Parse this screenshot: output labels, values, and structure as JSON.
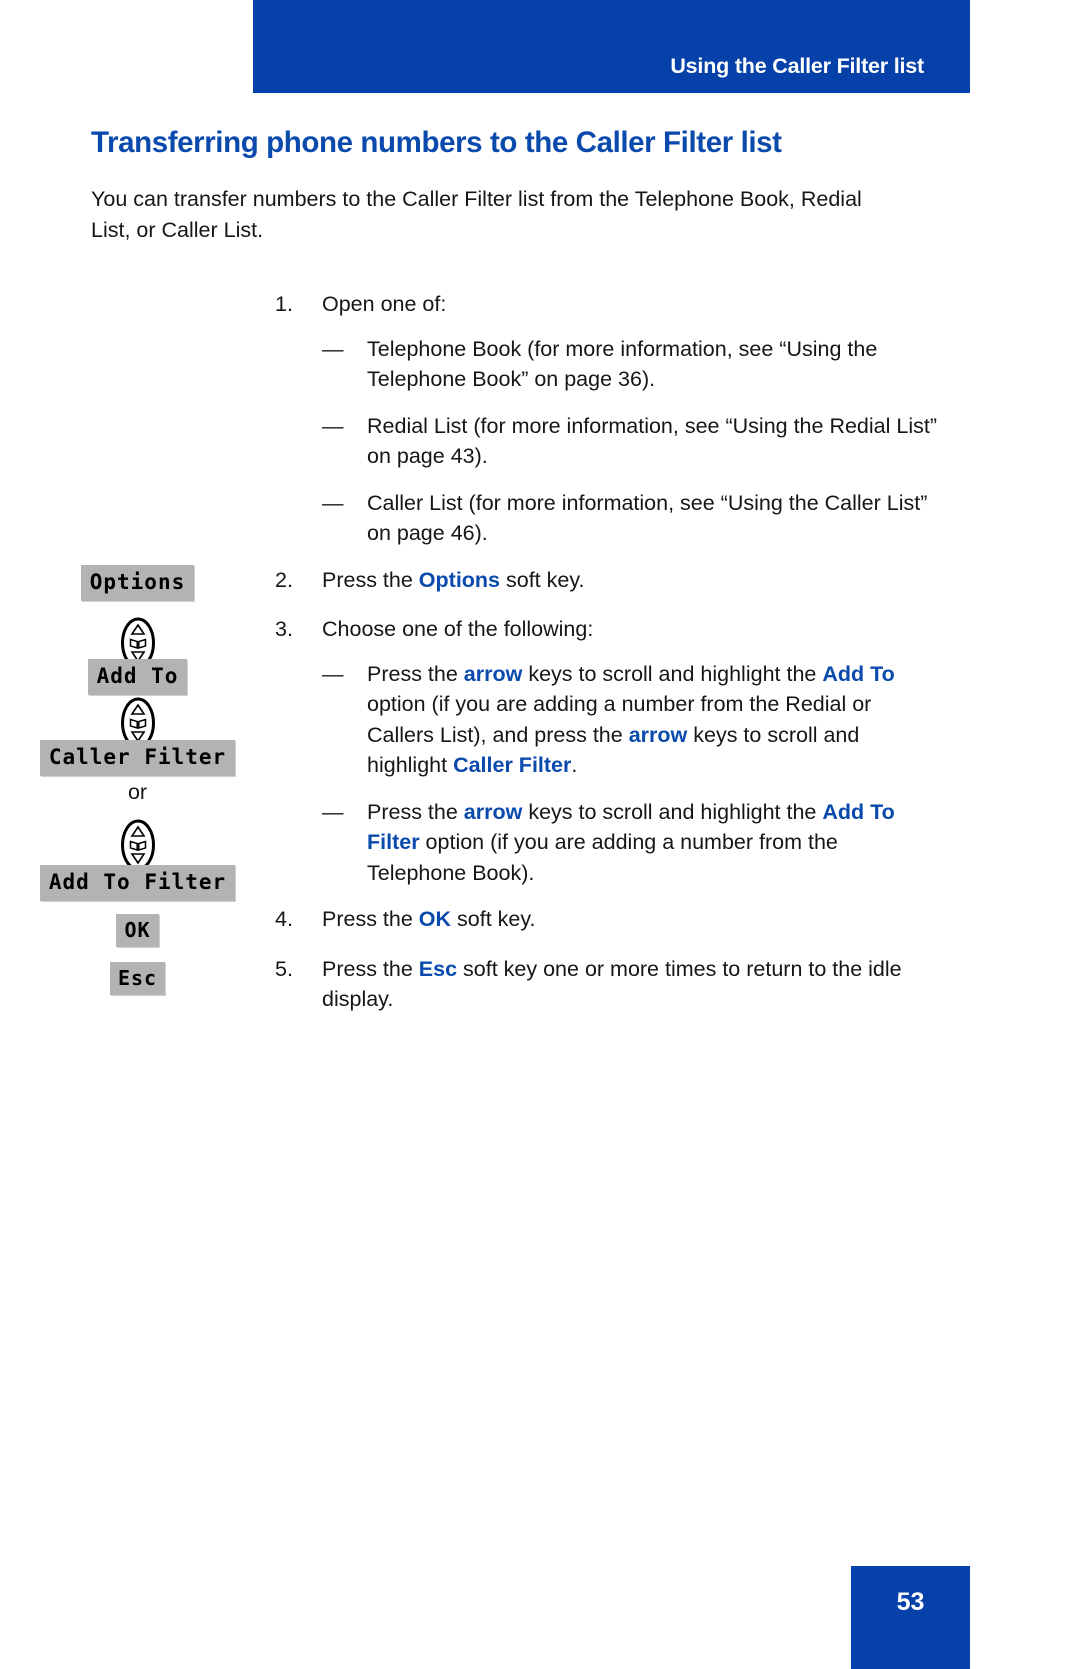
{
  "header": {
    "running_title": "Using the Caller Filter list",
    "band_color": "#0541a8"
  },
  "heading": "Transferring phone numbers to the Caller Filter list",
  "heading_color": "#0a4aad",
  "intro": "You can transfer numbers to the Caller Filter list from the Telephone Book, Redial List, or Caller List.",
  "steps": [
    {
      "number": "1.",
      "text": "Open one of:",
      "sub_items": [
        {
          "mark": "—",
          "text": "Telephone Book (for more information, see “Using the Telephone Book” on page 36)."
        },
        {
          "mark": "—",
          "text": "Redial List (for more information, see “Using the Redial List” on page 43)."
        },
        {
          "mark": "—",
          "text": "Caller List (for more information, see “Using the Caller List” on page 46)."
        }
      ]
    },
    {
      "number": "2.",
      "text_before": "Press the ",
      "keyword": "Options",
      "text_after": " soft key."
    },
    {
      "number": "3.",
      "text": "Choose one of the following:",
      "sub_items": [
        {
          "mark": "—",
          "parts": [
            {
              "t": "Press the ",
              "kw": false
            },
            {
              "t": "arrow",
              "kw": true
            },
            {
              "t": " keys to scroll and highlight the ",
              "kw": false
            },
            {
              "t": "Add To",
              "kw": true
            },
            {
              "t": " option (if you are adding a number from the Redial or Callers List), and press the ",
              "kw": false
            },
            {
              "t": "arrow",
              "kw": true
            },
            {
              "t": " keys to scroll and highlight ",
              "kw": false
            },
            {
              "t": "Caller Filter",
              "kw": true
            },
            {
              "t": ".",
              "kw": false
            }
          ]
        },
        {
          "mark": "—",
          "parts": [
            {
              "t": "Press the ",
              "kw": false
            },
            {
              "t": "arrow",
              "kw": true
            },
            {
              "t": " keys to scroll and highlight the ",
              "kw": false
            },
            {
              "t": "Add To Filter",
              "kw": true
            },
            {
              "t": " option (if you are adding a number from the Telephone Book).",
              "kw": false
            }
          ]
        }
      ]
    },
    {
      "number": "4.",
      "text_before": "Press the ",
      "keyword": "OK",
      "text_after": " soft key."
    },
    {
      "number": "5.",
      "text_before": "Press the ",
      "keyword": "Esc",
      "text_after": " soft key one or more times to return to the idle display."
    }
  ],
  "margin_graphics": {
    "lcd_options": "Options",
    "lcd_add_to": "Add To",
    "lcd_caller_filter": "Caller Filter",
    "or_label": "or",
    "lcd_add_to_filter": "Add To Filter",
    "lcd_ok": "OK",
    "lcd_esc": "Esc",
    "navigation_key_icon": "navigation-key-icon",
    "lcd_background": "#b3b3b3"
  },
  "footer": {
    "page_number": "53",
    "block_color": "#0541a8"
  }
}
